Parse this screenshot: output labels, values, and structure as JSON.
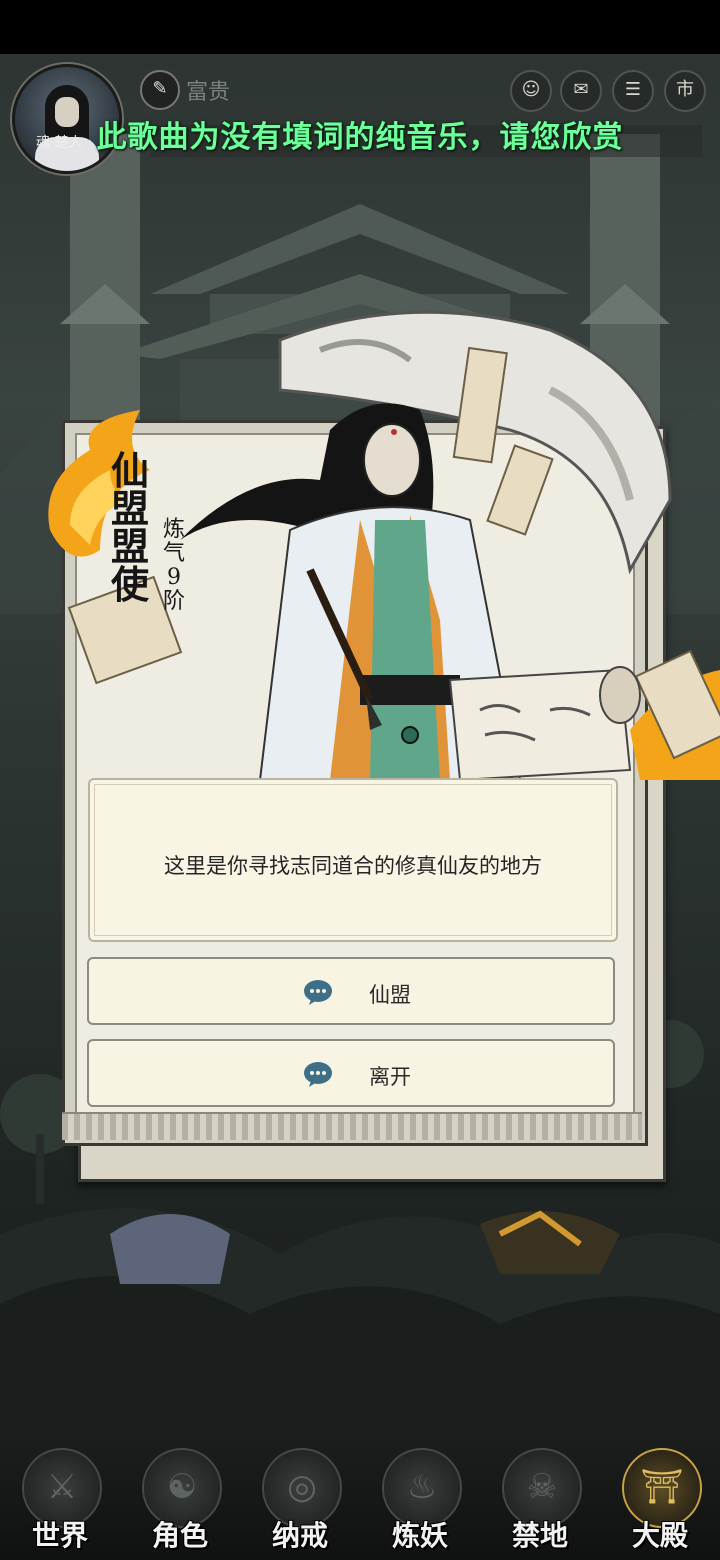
{
  "hud": {
    "avatar_name": "魂·楚人",
    "gold_label": "富贵",
    "icons": [
      "friends-icon",
      "mail-icon",
      "scroll-icon",
      "market-icon"
    ],
    "market_label": "市"
  },
  "subtitle": "此歌曲为没有填词的纯音乐，请您欣赏",
  "npc": {
    "title": "仙盟盟使",
    "rank": "炼气9阶"
  },
  "dialog": {
    "text": "这里是你寻找志同道合的修真仙友的地方",
    "choices": [
      {
        "label": "仙盟",
        "icon": "chat-bubble-icon"
      },
      {
        "label": "离开",
        "icon": "chat-bubble-icon"
      }
    ]
  },
  "nav": {
    "items": [
      {
        "label": "世界",
        "glyph": "⚔"
      },
      {
        "label": "角色",
        "glyph": "☯"
      },
      {
        "label": "纳戒",
        "glyph": "◎"
      },
      {
        "label": "炼妖",
        "glyph": "♨"
      },
      {
        "label": "禁地",
        "glyph": "☠"
      },
      {
        "label": "大殿",
        "glyph": "⛩"
      }
    ],
    "active_index": 5
  },
  "colors": {
    "subtitle": "#6dff9a",
    "accent_gold": "#c9a245",
    "chat_icon": "#3f6f86"
  }
}
